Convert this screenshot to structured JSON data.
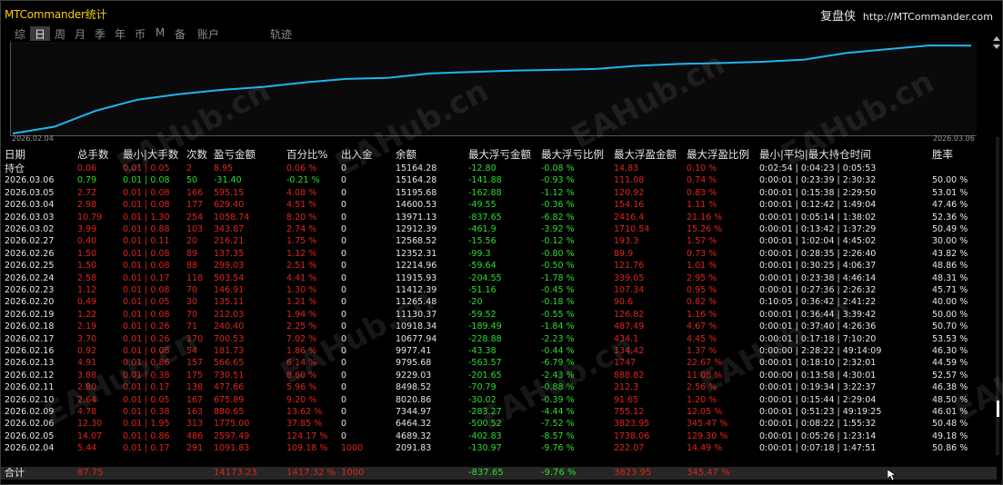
{
  "window": {
    "title": "MTCommander统计",
    "brand_cn": "复盘侠",
    "brand_url": "http://MTCommander.com"
  },
  "tabs": [
    "综",
    "日",
    "周",
    "月",
    "季",
    "年",
    "币",
    "M",
    "备",
    "账户",
    "轨迹"
  ],
  "active_tab": "日",
  "equity_chart": {
    "x_start": "2026.02.04",
    "x_end": "2026.03.06",
    "line_color": "#1fb4f0",
    "values": [
      1000,
      2091.83,
      4689.32,
      6464.32,
      7344.97,
      8020.86,
      8498.52,
      9229.03,
      9795.68,
      9977.41,
      10677.94,
      10918.34,
      11130.37,
      11265.48,
      11412.39,
      11915.93,
      12214.96,
      12352.31,
      12568.52,
      12912.39,
      13971.13,
      14600.53,
      15195.68,
      15164.28
    ]
  },
  "headers": [
    "日期",
    "总手数",
    "最小|大手数",
    "次数",
    "盈亏金额",
    "百分比%",
    "出入金",
    "余额",
    "最大浮亏金额",
    "最大浮亏比例",
    "最大浮盈金额",
    "最大浮盈比例",
    "最小|平均|最大持仓时间",
    "胜率"
  ],
  "rows": [
    {
      "date": "持仓",
      "lots": "0.06",
      "minmax": "0.01 | 0.05",
      "count": "2",
      "pnl": "8.95",
      "pct": "0.06 %",
      "io": "0",
      "balance": "15164.28",
      "max_fl": "-12.80",
      "max_flp": "-0.08 %",
      "max_fp": "14.83",
      "max_fpp": "0.10 %",
      "hold": "0:02:54 | 0:04:23 | 0:05:53",
      "win": "",
      "pnl_sign": "pos"
    },
    {
      "date": "2026.03.06",
      "lots": "0.79",
      "minmax": "0.01 | 0.08",
      "count": "50",
      "pnl": "-31.40",
      "pct": "-0.21 %",
      "io": "0",
      "balance": "15164.28",
      "max_fl": "-141.88",
      "max_flp": "-0.93 %",
      "max_fp": "111.08",
      "max_fpp": "0.74 %",
      "hold": "0:00:01 | 0:23:39 | 2:30:32",
      "win": "50.00 %",
      "pnl_sign": "neg"
    },
    {
      "date": "2026.03.05",
      "lots": "2.72",
      "minmax": "0.01 | 0.08",
      "count": "166",
      "pnl": "595.15",
      "pct": "4.08 %",
      "io": "0",
      "balance": "15195.68",
      "max_fl": "-162.88",
      "max_flp": "-1.12 %",
      "max_fp": "120.92",
      "max_fpp": "0.83 %",
      "hold": "0:00:01 | 0:15:38 | 2:29:50",
      "win": "53.01 %",
      "pnl_sign": "pos"
    },
    {
      "date": "2026.03.04",
      "lots": "2.98",
      "minmax": "0.01 | 0.08",
      "count": "177",
      "pnl": "629.40",
      "pct": "4.51 %",
      "io": "0",
      "balance": "14600.53",
      "max_fl": "-49.55",
      "max_flp": "-0.36 %",
      "max_fp": "154.16",
      "max_fpp": "1.11 %",
      "hold": "0:00:01 | 0:12:42 | 1:49:04",
      "win": "47.46 %",
      "pnl_sign": "pos"
    },
    {
      "date": "2026.03.03",
      "lots": "10.79",
      "minmax": "0.01 | 1.30",
      "count": "254",
      "pnl": "1058.74",
      "pct": "8.20 %",
      "io": "0",
      "balance": "13971.13",
      "max_fl": "-837.65",
      "max_flp": "-6.82 %",
      "max_fp": "2416.4",
      "max_fpp": "21.16 %",
      "hold": "0:00:01 | 0:05:14 | 1:38:02",
      "win": "52.36 %",
      "pnl_sign": "pos"
    },
    {
      "date": "2026.03.02",
      "lots": "3.99",
      "minmax": "0.01 | 0.88",
      "count": "103",
      "pnl": "343.87",
      "pct": "2.74 %",
      "io": "0",
      "balance": "12912.39",
      "max_fl": "-461.9",
      "max_flp": "-3.92 %",
      "max_fp": "1710.54",
      "max_fpp": "15.26 %",
      "hold": "0:00:01 | 0:13:42 | 1:37:29",
      "win": "50.49 %",
      "pnl_sign": "pos"
    },
    {
      "date": "2026.02.27",
      "lots": "0.40",
      "minmax": "0.01 | 0.11",
      "count": "20",
      "pnl": "216.21",
      "pct": "1.75 %",
      "io": "0",
      "balance": "12568.52",
      "max_fl": "-15.56",
      "max_flp": "-0.12 %",
      "max_fp": "193.3",
      "max_fpp": "1.57 %",
      "hold": "0:00:01 | 1:02:04 | 4:45:02",
      "win": "30.00 %",
      "pnl_sign": "pos"
    },
    {
      "date": "2026.02.26",
      "lots": "1.50",
      "minmax": "0.01 | 0.08",
      "count": "89",
      "pnl": "137.35",
      "pct": "1.12 %",
      "io": "0",
      "balance": "12352.31",
      "max_fl": "-99.3",
      "max_flp": "-0.80 %",
      "max_fp": "89.9",
      "max_fpp": "0.73 %",
      "hold": "0:00:01 | 0:28:35 | 2:26:40",
      "win": "43.82 %",
      "pnl_sign": "pos"
    },
    {
      "date": "2026.02.25",
      "lots": "1.50",
      "minmax": "0.01 | 0.08",
      "count": "88",
      "pnl": "299.03",
      "pct": "2.51 %",
      "io": "0",
      "balance": "12214.96",
      "max_fl": "-59.64",
      "max_flp": "-0.50 %",
      "max_fp": "121.76",
      "max_fpp": "1.01 %",
      "hold": "0:00:01 | 0:30:25 | 4:06:37",
      "win": "48.86 %",
      "pnl_sign": "pos"
    },
    {
      "date": "2026.02.24",
      "lots": "2.58",
      "minmax": "0.01 | 0.17",
      "count": "118",
      "pnl": "503.54",
      "pct": "4.41 %",
      "io": "0",
      "balance": "11915.93",
      "max_fl": "-204.55",
      "max_flp": "-1.78 %",
      "max_fp": "339.05",
      "max_fpp": "2.95 %",
      "hold": "0:00:01 | 0:23:38 | 4:46:14",
      "win": "48.31 %",
      "pnl_sign": "pos"
    },
    {
      "date": "2026.02.23",
      "lots": "1.12",
      "minmax": "0.01 | 0.08",
      "count": "70",
      "pnl": "146.91",
      "pct": "1.30 %",
      "io": "0",
      "balance": "11412.39",
      "max_fl": "-51.16",
      "max_flp": "-0.45 %",
      "max_fp": "107.34",
      "max_fpp": "0.95 %",
      "hold": "0:00:01 | 0:27:36 | 2:26:32",
      "win": "45.71 %",
      "pnl_sign": "pos"
    },
    {
      "date": "2026.02.20",
      "lots": "0.49",
      "minmax": "0.01 | 0.05",
      "count": "30",
      "pnl": "135.11",
      "pct": "1.21 %",
      "io": "0",
      "balance": "11265.48",
      "max_fl": "-20",
      "max_flp": "-0.18 %",
      "max_fp": "90.6",
      "max_fpp": "0.82 %",
      "hold": "0:10:05 | 0:36:42 | 2:41:22",
      "win": "40.00 %",
      "pnl_sign": "pos"
    },
    {
      "date": "2026.02.19",
      "lots": "1.22",
      "minmax": "0.01 | 0.08",
      "count": "70",
      "pnl": "212.03",
      "pct": "1.94 %",
      "io": "0",
      "balance": "11130.37",
      "max_fl": "-59.52",
      "max_flp": "-0.55 %",
      "max_fp": "126.82",
      "max_fpp": "1.16 %",
      "hold": "0:00:01 | 0:36:44 | 3:39:42",
      "win": "50.00 %",
      "pnl_sign": "pos"
    },
    {
      "date": "2026.02.18",
      "lots": "2.19",
      "minmax": "0.01 | 0.26",
      "count": "71",
      "pnl": "240.40",
      "pct": "2.25 %",
      "io": "0",
      "balance": "10918.34",
      "max_fl": "-189.49",
      "max_flp": "-1.84 %",
      "max_fp": "487.49",
      "max_fpp": "4.67 %",
      "hold": "0:00:01 | 0:37:40 | 4:26:36",
      "win": "50.70 %",
      "pnl_sign": "pos"
    },
    {
      "date": "2026.02.17",
      "lots": "3.70",
      "minmax": "0.01 | 0.26",
      "count": "170",
      "pnl": "700.53",
      "pct": "7.02 %",
      "io": "0",
      "balance": "10677.94",
      "max_fl": "-228.88",
      "max_flp": "-2.23 %",
      "max_fp": "434.1",
      "max_fpp": "4.45 %",
      "hold": "0:00:01 | 0:17:18 | 7:10:20",
      "win": "53.53 %",
      "pnl_sign": "pos"
    },
    {
      "date": "2026.02.16",
      "lots": "0.92",
      "minmax": "0.01 | 0.08",
      "count": "54",
      "pnl": "181.73",
      "pct": "1.86 %",
      "io": "0",
      "balance": "9977.41",
      "max_fl": "-43.38",
      "max_flp": "-0.44 %",
      "max_fp": "134.42",
      "max_fpp": "1.37 %",
      "hold": "0:00:00 | 2:28:22 | 49:14:09",
      "win": "46.30 %",
      "pnl_sign": "pos"
    },
    {
      "date": "2026.02.13",
      "lots": "4.91",
      "minmax": "0.01 | 0.86",
      "count": "157",
      "pnl": "566.65",
      "pct": "6.14 %",
      "io": "0",
      "balance": "9795.68",
      "max_fl": "-563.57",
      "max_flp": "-6.79 %",
      "max_fp": "1747",
      "max_fpp": "22.67 %",
      "hold": "0:00:01 | 0:18:10 | 2:32:01",
      "win": "44.59 %",
      "pnl_sign": "pos"
    },
    {
      "date": "2026.02.12",
      "lots": "3.88",
      "minmax": "0.01 | 0.38",
      "count": "175",
      "pnl": "730.51",
      "pct": "8.60 %",
      "io": "0",
      "balance": "9229.03",
      "max_fl": "-201.65",
      "max_flp": "-2.43 %",
      "max_fp": "888.82",
      "max_fpp": "11.08 %",
      "hold": "0:00:00 | 0:13:58 | 4:30:01",
      "win": "52.57 %",
      "pnl_sign": "pos"
    },
    {
      "date": "2026.02.11",
      "lots": "2.80",
      "minmax": "0.01 | 0.17",
      "count": "138",
      "pnl": "477.66",
      "pct": "5.96 %",
      "io": "0",
      "balance": "8498.52",
      "max_fl": "-70.79",
      "max_flp": "-0.88 %",
      "max_fp": "212.3",
      "max_fpp": "2.56 %",
      "hold": "0:00:01 | 0:19:34 | 3:22:37",
      "win": "46.38 %",
      "pnl_sign": "pos"
    },
    {
      "date": "2026.02.10",
      "lots": "2.64",
      "minmax": "0.01 | 0.05",
      "count": "167",
      "pnl": "675.89",
      "pct": "9.20 %",
      "io": "0",
      "balance": "8020.86",
      "max_fl": "-30.02",
      "max_flp": "-0.39 %",
      "max_fp": "91.65",
      "max_fpp": "1.20 %",
      "hold": "0:00:01 | 0:15:44 | 2:29:04",
      "win": "48.50 %",
      "pnl_sign": "pos"
    },
    {
      "date": "2026.02.09",
      "lots": "4.78",
      "minmax": "0.01 | 0.38",
      "count": "163",
      "pnl": "880.65",
      "pct": "13.62 %",
      "io": "0",
      "balance": "7344.97",
      "max_fl": "-283.27",
      "max_flp": "-4.44 %",
      "max_fp": "755.12",
      "max_fpp": "12.05 %",
      "hold": "0:00:01 | 0:51:23 | 49:19:25",
      "win": "46.01 %",
      "pnl_sign": "pos"
    },
    {
      "date": "2026.02.06",
      "lots": "12.30",
      "minmax": "0.01 | 1.95",
      "count": "313",
      "pnl": "1775.00",
      "pct": "37.85 %",
      "io": "0",
      "balance": "6464.32",
      "max_fl": "-500.52",
      "max_flp": "-7.52 %",
      "max_fp": "3823.95",
      "max_fpp": "345.47 %",
      "hold": "0:00:01 | 0:08:22 | 1:55:32",
      "win": "50.48 %",
      "pnl_sign": "pos"
    },
    {
      "date": "2026.02.05",
      "lots": "14.07",
      "minmax": "0.01 | 0.86",
      "count": "486",
      "pnl": "2597.49",
      "pct": "124.17 %",
      "io": "0",
      "balance": "4689.32",
      "max_fl": "-402.83",
      "max_flp": "-8.57 %",
      "max_fp": "1738.06",
      "max_fpp": "129.30 %",
      "hold": "0:00:01 | 0:05:26 | 1:23:14",
      "win": "49.18 %",
      "pnl_sign": "pos"
    },
    {
      "date": "2026.02.04",
      "lots": "5.44",
      "minmax": "0.01 | 0.17",
      "count": "291",
      "pnl": "1091.83",
      "pct": "109.18 %",
      "io": "1000",
      "balance": "2091.83",
      "max_fl": "-130.97",
      "max_flp": "-9.76 %",
      "max_fp": "222.07",
      "max_fpp": "14.49 %",
      "hold": "0:00:01 | 0:07:18 | 1:47:51",
      "win": "50.86 %",
      "pnl_sign": "pos"
    }
  ],
  "total": {
    "label": "合计",
    "lots": "87.75",
    "pnl": "14173.23",
    "pct": "1417.32 %",
    "io": "1000",
    "max_fl": "-837.65",
    "max_flp": "-9.76 %",
    "max_fp": "3823.95",
    "max_fpp": "345.47 %"
  },
  "watermark": "EAHub.cn",
  "colors": {
    "profit": "#e0241c",
    "loss": "#2cdc2c",
    "title": "#f5d000",
    "line": "#1fb4f0"
  }
}
